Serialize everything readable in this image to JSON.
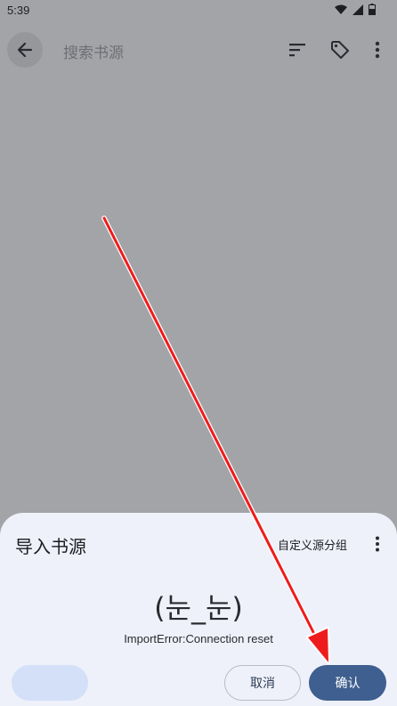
{
  "status_bar": {
    "time": "5:39"
  },
  "toolbar": {
    "search_placeholder": "搜索书源"
  },
  "dialog": {
    "title": "导入书源",
    "custom_group_label": "自定义源分组",
    "emoticon": "(눈_눈)",
    "message": "ImportError:Connection reset",
    "cancel_label": "取消",
    "confirm_label": "确认"
  },
  "colors": {
    "scrim": "#a3a4a8",
    "sheet_bg": "#eef1fa",
    "primary": "#3e5f8f",
    "disabled_button": "#d3e0f7",
    "annotation_arrow": "#ee1c1c"
  }
}
